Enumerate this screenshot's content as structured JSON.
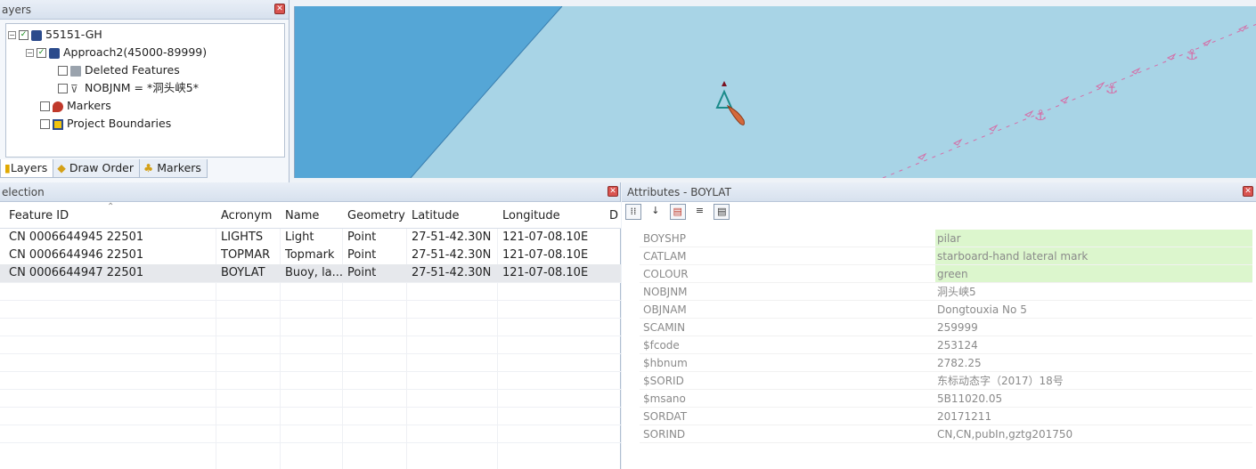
{
  "layers": {
    "title": "ayers",
    "items": [
      {
        "label": "55151-GH"
      },
      {
        "label": "Approach2(45000-89999)"
      },
      {
        "label": "Deleted Features"
      },
      {
        "label": "NOBJNM = *洞头峡5*"
      },
      {
        "label": "Markers"
      },
      {
        "label": "Project Boundaries"
      }
    ],
    "tabs": [
      "Layers",
      "Draw Order",
      "Markers"
    ]
  },
  "selection": {
    "title": "election",
    "columns": [
      "Feature ID",
      "Acronym",
      "Name",
      "Geometry",
      "Latitude",
      "Longitude",
      "D"
    ],
    "rows": [
      [
        "CN 0006644945 22501",
        "LIGHTS",
        "Light",
        "Point",
        "27-51-42.30N",
        "121-07-08.10E"
      ],
      [
        "CN 0006644946 22501",
        "TOPMAR",
        "Topmark",
        "Point",
        "27-51-42.30N",
        "121-07-08.10E"
      ],
      [
        "CN 0006644947 22501",
        "BOYLAT",
        "Buoy, la...",
        "Point",
        "27-51-42.30N",
        "121-07-08.10E"
      ]
    ]
  },
  "attributes": {
    "title": "Attributes - BOYLAT",
    "rows": [
      {
        "key": "BOYSHP",
        "value": "pilar",
        "highlight": true
      },
      {
        "key": "CATLAM",
        "value": "starboard-hand lateral mark",
        "highlight": true
      },
      {
        "key": "COLOUR",
        "value": "green",
        "highlight": true
      },
      {
        "key": "NOBJNM",
        "value": "洞头峡5",
        "highlight": false
      },
      {
        "key": "OBJNAM",
        "value": "Dongtouxia No 5",
        "highlight": false
      },
      {
        "key": "SCAMIN",
        "value": "259999",
        "highlight": false
      },
      {
        "key": "$fcode",
        "value": "253124",
        "highlight": false
      },
      {
        "key": "$hbnum",
        "value": "2782.25",
        "highlight": false
      },
      {
        "key": "$SORID",
        "value": "东标动态字（2017）18号",
        "highlight": false
      },
      {
        "key": "$msano",
        "value": "5B11020.05",
        "highlight": false
      },
      {
        "key": "SORDAT",
        "value": "20171211",
        "highlight": false
      },
      {
        "key": "SORIND",
        "value": "CN,CN,pubIn,gztg201750",
        "highlight": false
      }
    ]
  },
  "colors": {
    "map_water": "#a8d4e6",
    "map_deep": "#4f9fd1",
    "highlight": "#dcf6cd",
    "close": "#d9534f"
  }
}
